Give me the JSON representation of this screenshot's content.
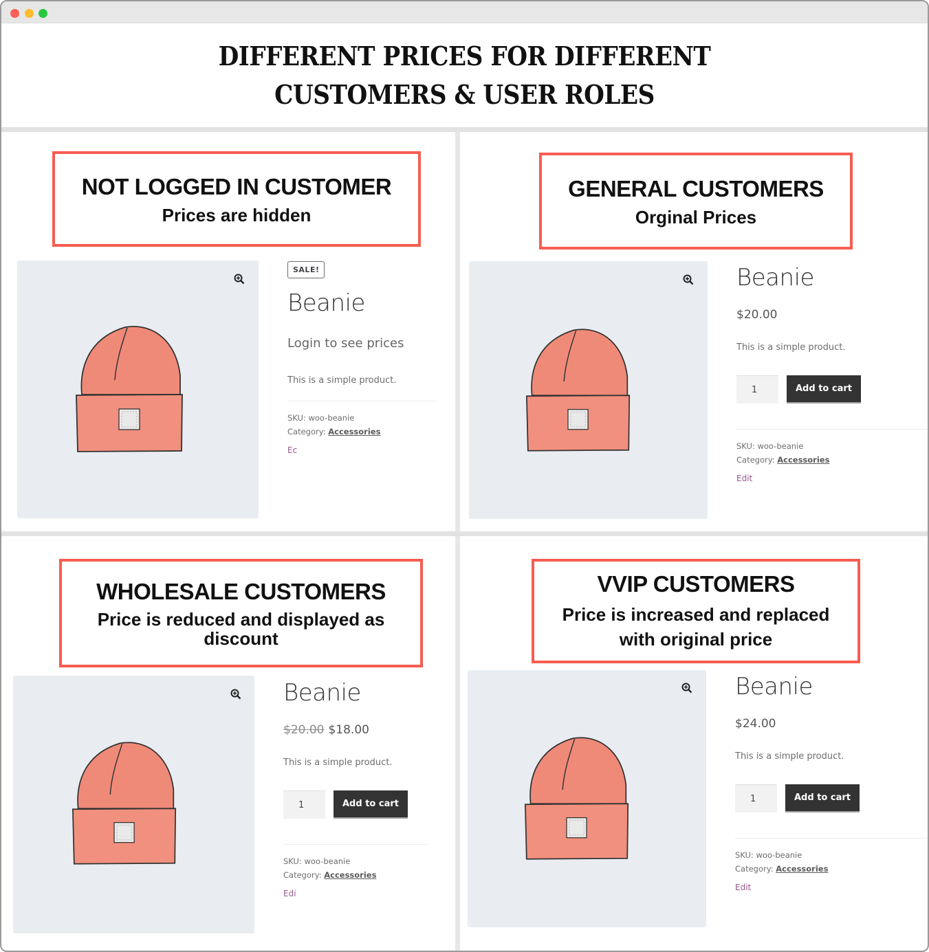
{
  "window": {
    "controls": [
      "close",
      "minimize",
      "maximize"
    ]
  },
  "headline": {
    "line1": "DIFFERENT PRICES FOR DIFFERENT",
    "line2": "CUSTOMERS & USER ROLES"
  },
  "colors": {
    "label_border": "#f65d50",
    "button_bg": "#333333",
    "edit_link": "#96588a",
    "image_bg": "#e9edf2",
    "beanie": "#f08a78"
  },
  "panels": [
    {
      "label_title": "NOT LOGGED IN CUSTOMER",
      "label_sub": "Prices are hidden",
      "sale_badge": "SALE!",
      "product_title": "Beanie",
      "price_message": "Login to see prices",
      "description": "This is a simple product.",
      "sku_label": "SKU:",
      "sku": "woo-beanie",
      "category_label": "Category:",
      "category": "Accessories",
      "edit": "Ec",
      "zoom_icon": "magnifier-plus-icon"
    },
    {
      "label_title": "GENERAL CUSTOMERS",
      "label_sub": "Orginal Prices",
      "product_title": "Beanie",
      "price": "$20.00",
      "description": "This is a simple product.",
      "quantity": "1",
      "add_to_cart": "Add to cart",
      "sku_label": "SKU:",
      "sku": "woo-beanie",
      "category_label": "Category:",
      "category": "Accessories",
      "edit": "Edit",
      "zoom_icon": "magnifier-plus-icon"
    },
    {
      "label_title": "WHOLESALE CUSTOMERS",
      "label_sub": "Price is reduced and displayed  as discount",
      "product_title": "Beanie",
      "old_price": "$20.00",
      "price": "$18.00",
      "description": "This is a simple product.",
      "quantity": "1",
      "add_to_cart": "Add to cart",
      "sku_label": "SKU:",
      "sku": "woo-beanie",
      "category_label": "Category:",
      "category": "Accessories",
      "edit": "Edi",
      "zoom_icon": "magnifier-plus-icon"
    },
    {
      "label_title": "VVIP CUSTOMERS",
      "label_sub": "Price is increased and replaced with original price",
      "product_title": "Beanie",
      "price": "$24.00",
      "description": "This is a simple product.",
      "quantity": "1",
      "add_to_cart": "Add to cart",
      "sku_label": "SKU:",
      "sku": "woo-beanie",
      "category_label": "Category:",
      "category": "Accessories",
      "edit": "Edit",
      "zoom_icon": "magnifier-plus-icon"
    }
  ]
}
